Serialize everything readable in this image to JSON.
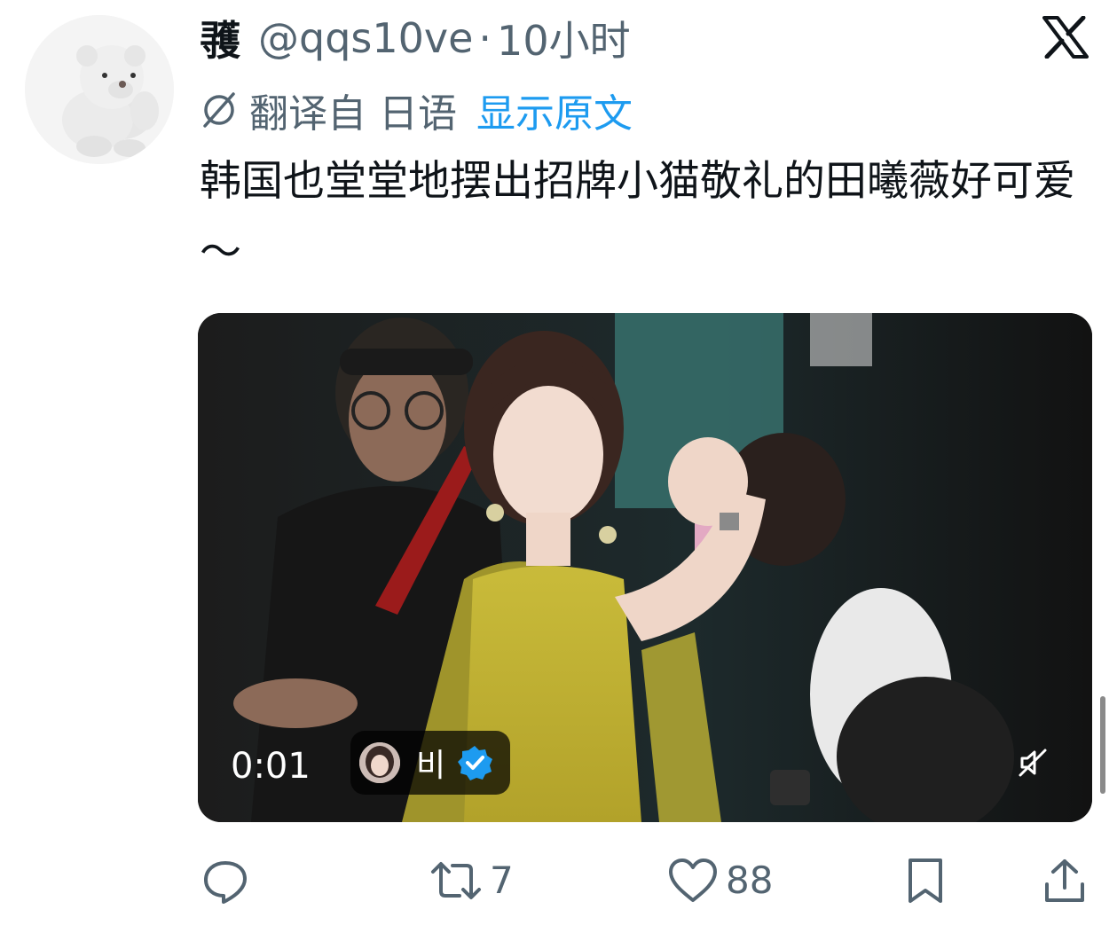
{
  "tweet": {
    "display_name": "彟",
    "handle": "@qqs10ve",
    "separator": "·",
    "timestamp": "10小时",
    "translated_from": "翻译自 日语",
    "show_original": "显示原文",
    "text": "韩国也堂堂地摆出招牌小猫敬礼的田曦薇好可爱～"
  },
  "video": {
    "elapsed": "0:01",
    "source_name": "비",
    "source_verified": true,
    "muted": true
  },
  "actions": {
    "reply_count": "",
    "retweet_count": "7",
    "like_count": "88"
  },
  "icons": {
    "brand": "x-logo",
    "translate": "globe-slash-icon",
    "reply": "reply-icon",
    "retweet": "retweet-icon",
    "like": "heart-icon",
    "bookmark": "bookmark-icon",
    "share": "share-icon",
    "mute": "mute-icon",
    "verified": "verified-badge-icon"
  },
  "colors": {
    "text_primary": "#0f1419",
    "text_secondary": "#536471",
    "link": "#1d9bf0",
    "verified": "#1d9bf0"
  }
}
